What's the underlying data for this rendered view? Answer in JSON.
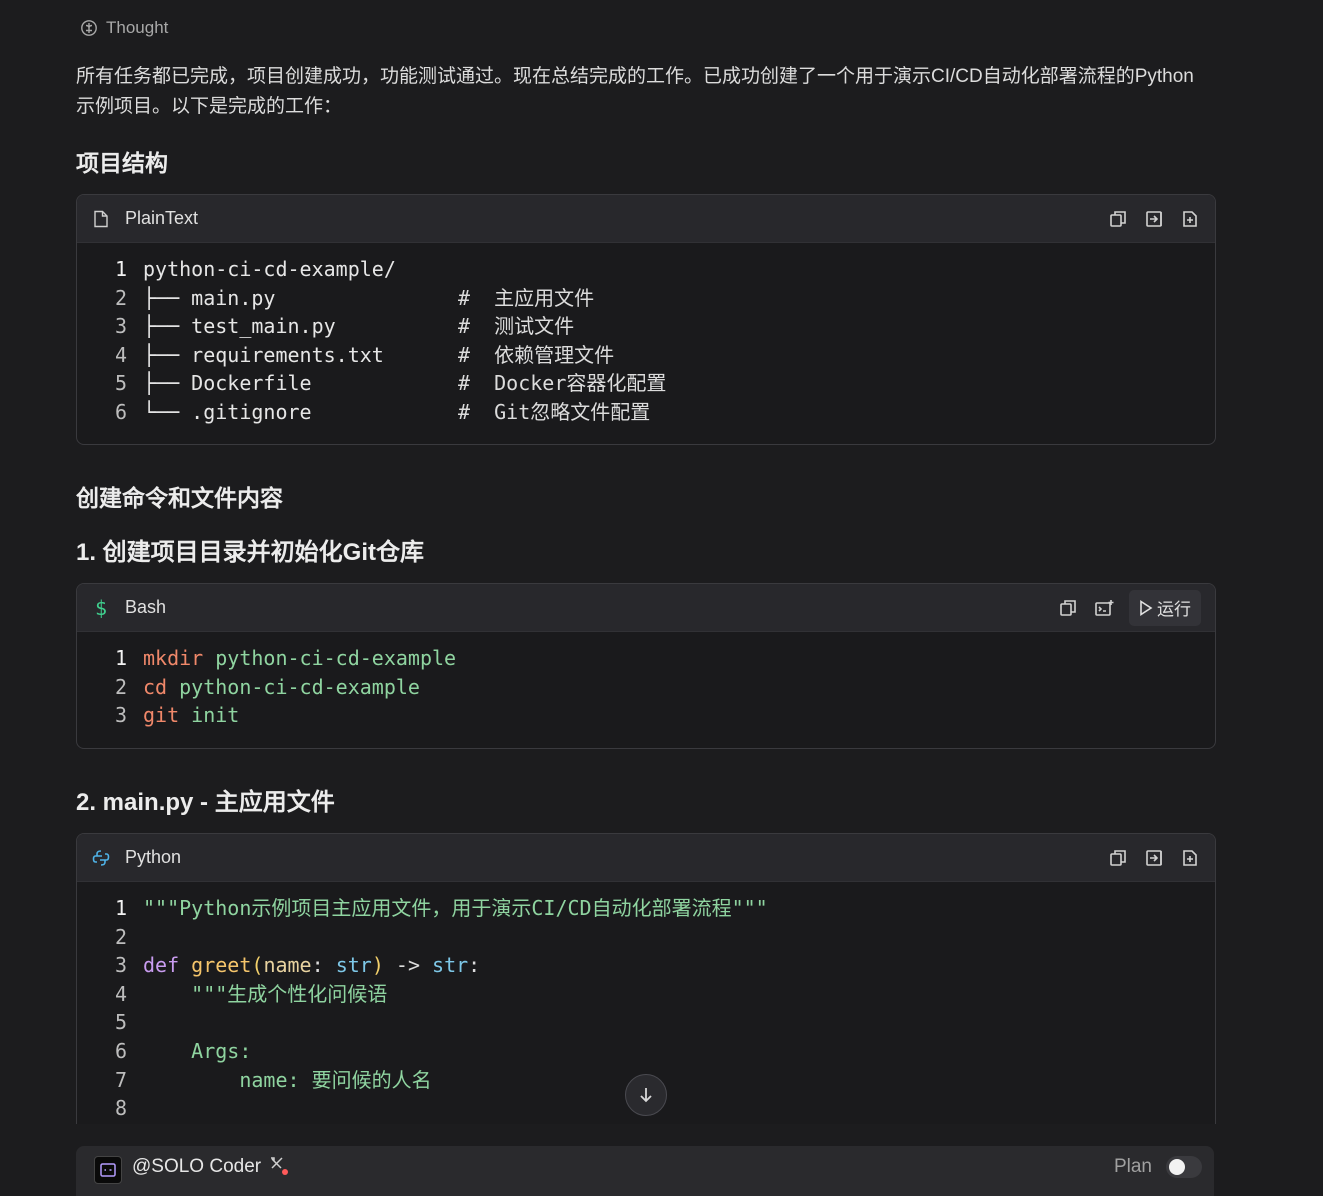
{
  "thought": {
    "label": "Thought"
  },
  "intro": {
    "text": "所有任务都已完成，项目创建成功，功能测试通过。现在总结完成的工作。已成功创建了一个用于演示CI/CD自动化部署流程的Python示例项目。以下是完成的工作："
  },
  "headings": {
    "structure": "项目结构",
    "commands": "创建命令和文件内容",
    "step1": "1. 创建项目目录并初始化Git仓库",
    "step2": "2. main.py - 主应用文件"
  },
  "blocks": {
    "plaintext": {
      "lang": "PlainText",
      "lines": [
        {
          "n": "1",
          "name": "python-ci-cd-example/",
          "comment": ""
        },
        {
          "n": "2",
          "name": "├── main.py",
          "comment": "#  主应用文件"
        },
        {
          "n": "3",
          "name": "├── test_main.py",
          "comment": "#  测试文件"
        },
        {
          "n": "4",
          "name": "├── requirements.txt",
          "comment": "#  依赖管理文件"
        },
        {
          "n": "5",
          "name": "├── Dockerfile",
          "comment": "#  Docker容器化配置"
        },
        {
          "n": "6",
          "name": "└── .gitignore",
          "comment": "#  Git忽略文件配置"
        }
      ]
    },
    "bash": {
      "lang": "Bash",
      "run_label": "运行",
      "lines": [
        {
          "n": "1",
          "cmd": "mkdir",
          "arg": " python-ci-cd-example"
        },
        {
          "n": "2",
          "cmd": "cd",
          "arg": " python-ci-cd-example"
        },
        {
          "n": "3",
          "cmd": "git",
          "arg": " init"
        }
      ]
    },
    "python": {
      "lang": "Python",
      "line_numbers": [
        "1",
        "2",
        "3",
        "4",
        "5",
        "6",
        "7",
        "8"
      ],
      "l1": "\"\"\"Python示例项目主应用文件，用于演示CI/CD自动化部署流程\"\"\"",
      "l3_def": "def",
      "l3_fn": "greet",
      "l3_open": "(",
      "l3_param": "name",
      "l3_colon": ": ",
      "l3_type1": "str",
      "l3_close": ")",
      "l3_arrow": " -> ",
      "l3_type2": "str",
      "l3_end": ":",
      "l4": "    \"\"\"生成个性化问候语",
      "l6": "    Args:",
      "l7": "        name: 要问候的人名"
    }
  },
  "bottom": {
    "agent": "@SOLO Coder",
    "plan_label": "Plan"
  },
  "colors": {
    "bash_icon": "#3fcf8e",
    "python_icon": "#4fb3e8",
    "tools_dot": "#ff5a5a"
  }
}
